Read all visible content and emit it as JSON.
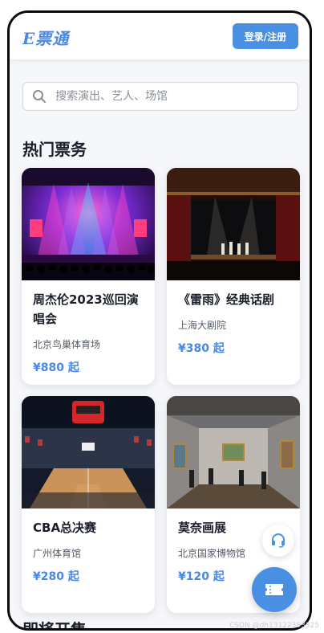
{
  "header": {
    "logo_text": "E票通",
    "login_label": "登录/注册"
  },
  "search": {
    "placeholder": "搜索演出、艺人、场馆"
  },
  "hot_section": {
    "title": "热门票务",
    "cards": [
      {
        "title": "周杰伦2023巡回演唱会",
        "venue": "北京鸟巢体育场",
        "price": "¥880 起",
        "image": "concert-stage-photo"
      },
      {
        "title": "《雷雨》经典话剧",
        "venue": "上海大剧院",
        "price": "¥380 起",
        "image": "theater-stage-photo"
      },
      {
        "title": "CBA总决赛",
        "venue": "广州体育馆",
        "price": "¥280 起",
        "image": "basketball-arena-photo"
      },
      {
        "title": "莫奈画展",
        "venue": "北京国家博物馆",
        "price": "¥120 起",
        "image": "art-gallery-photo"
      }
    ]
  },
  "next_section": {
    "title": "即将开售"
  },
  "floating": {
    "service_icon": "headset-icon",
    "ticket_icon": "ticket-icon"
  },
  "watermark": "CSDN @dh13122393325",
  "colors": {
    "brand": "#4a90e2",
    "price": "#4a88e4",
    "border": "#0b0b0b"
  }
}
